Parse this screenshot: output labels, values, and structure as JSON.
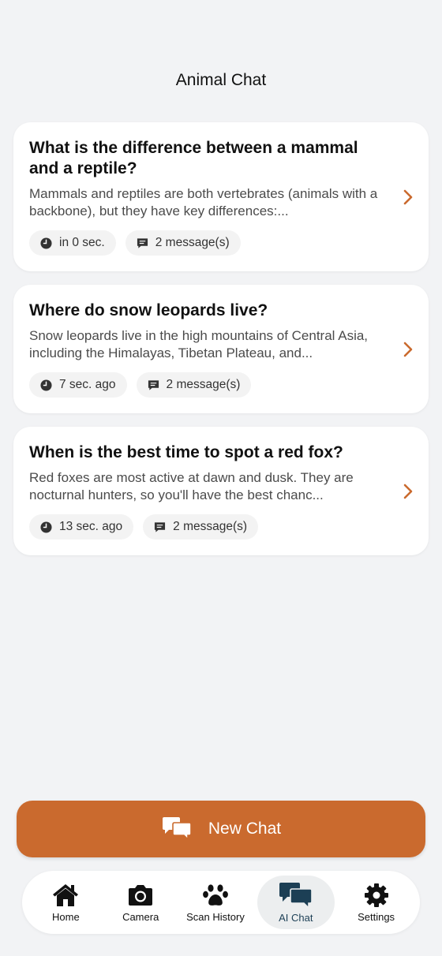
{
  "header": {
    "title": "Animal Chat"
  },
  "chats": [
    {
      "title": "What is the difference between a mammal and a reptile?",
      "preview": "Mammals and reptiles are both vertebrates (animals with a backbone), but they have key differences:...",
      "time": "in 0 sec.",
      "messages": "2 message(s)"
    },
    {
      "title": "Where do snow leopards live?",
      "preview": "Snow leopards live in the high mountains of Central Asia, including the Himalayas, Tibetan Plateau, and...",
      "time": "7 sec. ago",
      "messages": "2 message(s)"
    },
    {
      "title": "When is the best time to spot a red fox?",
      "preview": "Red foxes are most active at dawn and dusk. They are nocturnal hunters, so you'll have the best chanc...",
      "time": "13 sec. ago",
      "messages": "2 message(s)"
    }
  ],
  "new_chat": {
    "label": "New Chat"
  },
  "tabbar": {
    "home": "Home",
    "camera": "Camera",
    "scan_history": "Scan History",
    "ai_chat": "AI Chat",
    "settings": "Settings"
  },
  "colors": {
    "accent": "#ca6a2e",
    "background": "#f2f3f5",
    "active_tab_icon": "#1c3f55"
  }
}
